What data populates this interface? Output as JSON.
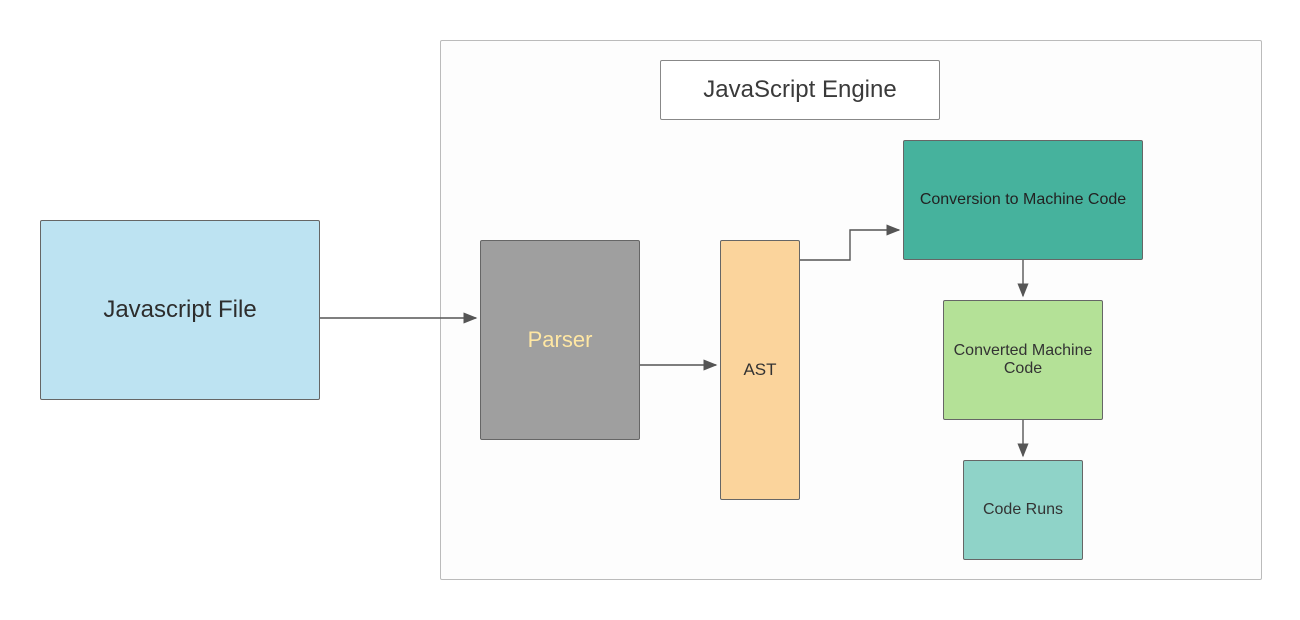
{
  "engine": {
    "title": "JavaScript Engine"
  },
  "nodes": {
    "js_file": "Javascript File",
    "parser": "Parser",
    "ast": "AST",
    "machine_conversion": "Conversion to Machine Code",
    "converted_code": "Converted Machine Code",
    "code_runs": "Code Runs"
  },
  "colors": {
    "js_file": "#bde3f2",
    "parser": "#9f9f9f",
    "ast": "#fbd49c",
    "machine_conversion": "#46b29d",
    "converted_code": "#b4e197",
    "code_runs": "#8fd3c8",
    "engine_border": "#bbbbbb",
    "arrow": "#555555"
  }
}
